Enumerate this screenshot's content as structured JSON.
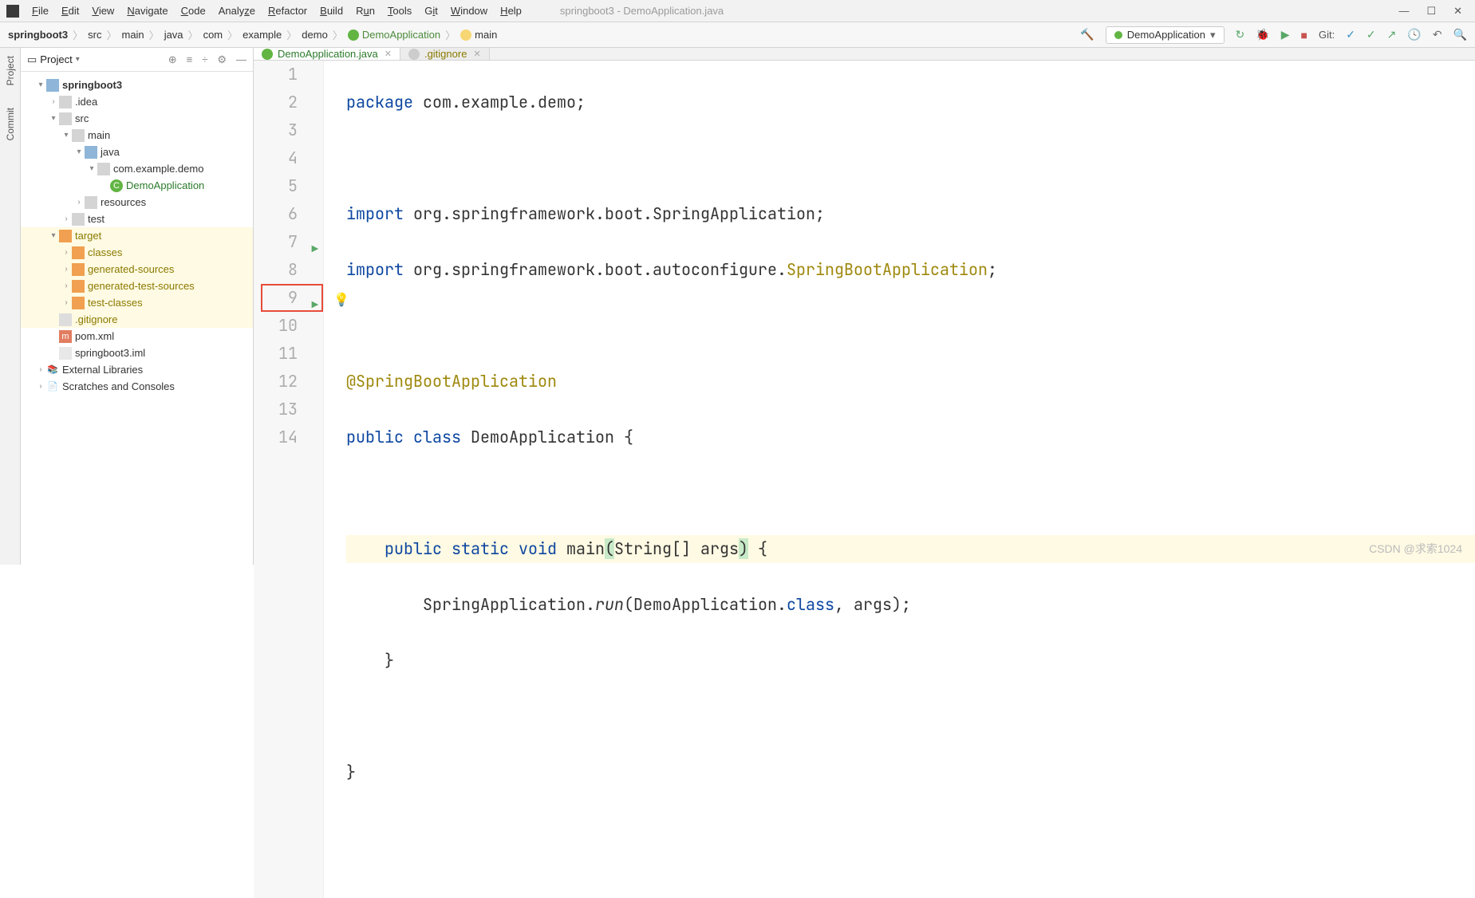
{
  "window": {
    "title": "springboot3 - DemoApplication.java"
  },
  "menu": [
    "File",
    "Edit",
    "View",
    "Navigate",
    "Code",
    "Analyze",
    "Refactor",
    "Build",
    "Run",
    "Tools",
    "Git",
    "Window",
    "Help"
  ],
  "breadcrumb": {
    "root": "springboot3",
    "parts": [
      "src",
      "main",
      "java",
      "com",
      "example",
      "demo"
    ],
    "class": "DemoApplication",
    "method": "main"
  },
  "runConfig": {
    "name": "DemoApplication"
  },
  "toolbar": {
    "git_label": "Git:"
  },
  "project": {
    "title": "Project",
    "tree": {
      "root": "springboot3",
      "idea": ".idea",
      "src": "src",
      "main": "main",
      "java": "java",
      "pkg": "com.example.demo",
      "app": "DemoApplication",
      "resources": "resources",
      "test": "test",
      "target": "target",
      "classes": "classes",
      "gensrc": "generated-sources",
      "gentsrc": "generated-test-sources",
      "testcls": "test-classes",
      "gitignore": ".gitignore",
      "pom": "pom.xml",
      "iml": "springboot3.iml",
      "extlib": "External Libraries",
      "scratch": "Scratches and Consoles"
    }
  },
  "sideTabs": {
    "project": "Project",
    "commit": "Commit"
  },
  "tabs": [
    {
      "label": "DemoApplication.java",
      "type": "c"
    },
    {
      "label": ".gitignore",
      "type": "g"
    }
  ],
  "code": {
    "l1": {
      "pkg": "package",
      "path": "com.example.demo"
    },
    "l3": {
      "imp": "import",
      "p": "org.springframework.boot.SpringApplication"
    },
    "l4": {
      "imp": "import",
      "p": "org.springframework.boot.autoconfigure.",
      "cls": "SpringBootApplication"
    },
    "l6": {
      "ann": "@SpringBootApplication"
    },
    "l7": {
      "pub": "public",
      "cls": "class",
      "name": "DemoApplication",
      "br": "{"
    },
    "l9": {
      "pub": "public",
      "st": "static",
      "vd": "void",
      "m": "main",
      "args": "String[] args",
      "br": "{"
    },
    "l10": {
      "call": "SpringApplication.",
      "run": "run",
      "arg1": "DemoApplication.",
      "cls": "class",
      "arg2": ", args);"
    },
    "l11": "}",
    "l13": "}"
  },
  "watermark": "CSDN @求索1024"
}
